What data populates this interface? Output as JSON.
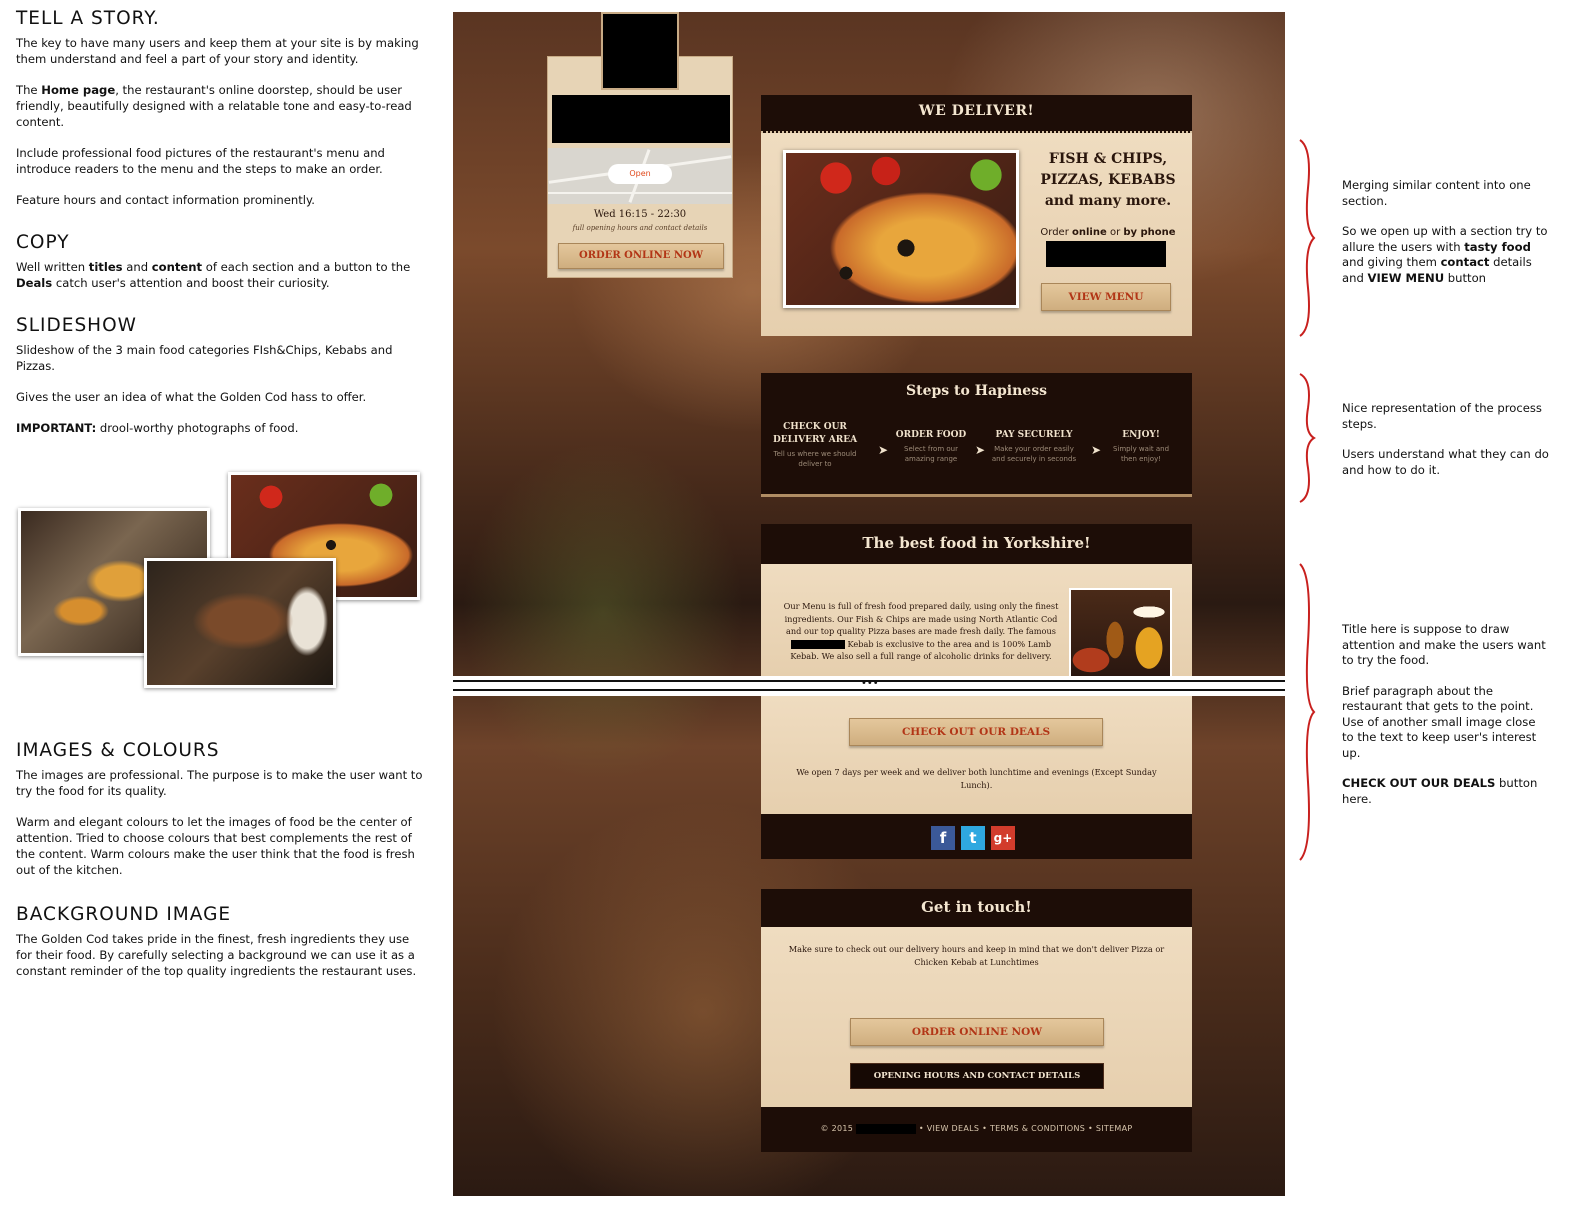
{
  "notes": {
    "story": {
      "title": "TELL A STORY.",
      "p1": "The key to have many users and keep them at your site is by making them understand and feel a part of your story and identity.",
      "p2_bold": "Home page",
      "p2_pre": "The ",
      "p2_post": ", the restaurant's online doorstep, should be user friendly, beautifully designed with a relatable tone and easy-to-read content.",
      "p3": "Include professional food pictures of the restaurant's menu and introduce readers to the menu and the steps to make an order.",
      "p4": "Feature hours and contact information prominently."
    },
    "copy": {
      "title": "COPY",
      "pre": "Well written ",
      "b1": "titles",
      "mid1": " and ",
      "b2": "content",
      "mid2": " of each section and a button to the ",
      "b3": "Deals",
      "post": " catch user's attention and boost their curiosity."
    },
    "slideshow": {
      "title": "SLIDESHOW",
      "p1": "Slideshow of the 3 main food categories FIsh&Chips, Kebabs and Pizzas.",
      "p2": "Gives the user an idea of what the Golden Cod hass to offer.",
      "p3_bold": "IMPORTANT:",
      "p3": " drool-worthy photographs of food."
    },
    "images": {
      "title": "IMAGES & COLOURS",
      "p1": "The images are professional. The purpose is to make the user want to try the food for its quality.",
      "p2": "Warm and elegant colours to let the images of food be the center of attention. Tried to choose colours that best complements the rest of the content. Warm colours make the user think that the food is fresh out of the kitchen."
    },
    "background": {
      "title": "BACKGROUND IMAGE",
      "p1": "The Golden Cod takes pride in the finest, fresh ingredients they use for their food. By carefully selecting a background we can use it as a constant reminder of the top quality ingredients the restaurant uses."
    }
  },
  "mockup": {
    "widget": {
      "map_pin": "Open",
      "time": "Wed 16:15 - 22:30",
      "time_sub": "full opening hours and contact details",
      "order_button": "ORDER ONLINE NOW"
    },
    "deliver": {
      "header": "WE DELIVER!",
      "title_lines": [
        "FISH & CHIPS,",
        "PIZZAS, KEBABS",
        "and many more."
      ],
      "order_pre": "Order ",
      "order_b1": "online",
      "order_mid": " or ",
      "order_b2": "by phone",
      "menu_button": "VIEW MENU"
    },
    "steps": {
      "header": "Steps to Hapiness",
      "items": [
        {
          "title": "CHECK OUR DELIVERY AREA",
          "desc": "Tell us where we should deliver to"
        },
        {
          "title": "ORDER FOOD",
          "desc": "Select from our amazing range"
        },
        {
          "title": "PAY SECURELY",
          "desc": "Make your order easily and securely in seconds"
        },
        {
          "title": "ENJOY!",
          "desc": "Simply wait and then enjoy!"
        }
      ]
    },
    "best": {
      "header": "The best food in Yorkshire!",
      "text_pre": "Our Menu is full of fresh food prepared daily, using only the finest ingredients. Our Fish & Chips are made using North Atlantic Cod and our top quality Pizza bases are made fresh daily. The famous ",
      "text_post": " Kebab is exclusive to the area and is 100% Lamb Kebab. We also sell a full range of alcoholic drinks for delivery."
    },
    "deals": {
      "button": "CHECK OUT OUR DEALS",
      "text": "We open 7 days per week and we deliver both lunchtime and evenings (Except Sunday Lunch)."
    },
    "social": {
      "facebook": "f",
      "twitter": "t",
      "google": "g+"
    },
    "touch": {
      "header": "Get in touch!",
      "text": "Make sure to check out our delivery hours and keep in mind that we don't deliver Pizza or Chicken Kebab at Lunchtimes",
      "order_button": "ORDER ONLINE NOW",
      "hours_button": "OPENING HOURS AND CONTACT DETAILS"
    },
    "footer": {
      "copyright": "© 2015",
      "links": "• VIEW DEALS • TERMS & CONDITIONS • SITEMAP"
    }
  },
  "annotations": {
    "a1": {
      "p1": "Merging similar content into one section.",
      "p2_pre": "So we open up with a section try to allure the users with ",
      "p2_b1": "tasty food",
      "p2_mid": " and giving them ",
      "p2_b2": "contact",
      "p2_mid2": " details and ",
      "p2_b3": "VIEW MENU",
      "p2_post": " button"
    },
    "a2": {
      "p1": "Nice representation of the process steps.",
      "p2": "Users understand what they can do and how to do it."
    },
    "a3": {
      "p1": "Title here is suppose to draw attention and make the users want to try the food.",
      "p2": "Brief paragraph about the restaurant that gets to the point. Use of another small image close to the text to keep user's interest up.",
      "p3_bold": "CHECK OUT OUR DEALS",
      "p3": " button here."
    },
    "brace_color": "#c8201e"
  }
}
